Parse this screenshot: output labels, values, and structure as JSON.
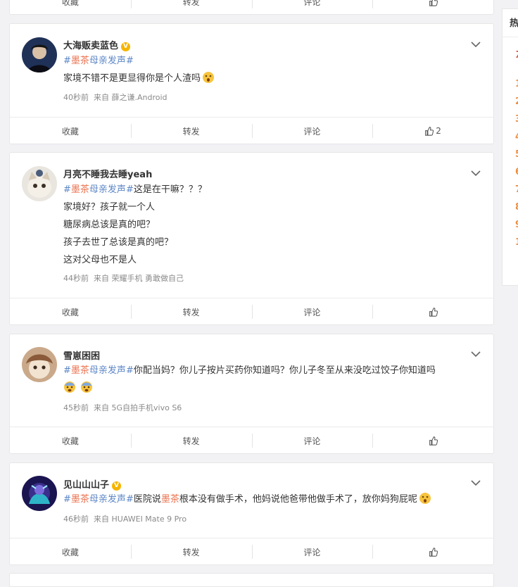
{
  "colors": {
    "hashtag_red": "#eb7350",
    "hashtag_blue": "#5d87c6",
    "page_bg": "#f2f2f5",
    "verified": "#f5b400"
  },
  "top_partial_actions": {
    "collect": "收藏",
    "repost": "转发",
    "comment": "评论"
  },
  "posts": [
    {
      "username": "大海贩卖蓝色",
      "verified": true,
      "lines": [
        {
          "tag_a": "#",
          "tag_b": "墨茶",
          "tag_c": "母亲发声",
          "tag_d": "#",
          "text": ""
        },
        {
          "text": "家境不错不是更显得你是个人渣吗"
        }
      ],
      "emoji": "astonished-emoji",
      "time": "40秒前",
      "source": "来自 薛之谦.Android",
      "actions": {
        "collect": "收藏",
        "repost": "转发",
        "comment": "评论",
        "likes": "2"
      }
    },
    {
      "username": "月亮不睡我去睡yeah",
      "verified": false,
      "lines": [
        {
          "tag_a": "#",
          "tag_b": "墨茶",
          "tag_c": "母亲发声",
          "tag_d": "#",
          "text": "这是在干嘛？？？"
        },
        {
          "text": "家境好？孩子就一个人"
        },
        {
          "text": "糖尿病总该是真的吧？"
        },
        {
          "text": "孩子去世了总该是真的吧？"
        },
        {
          "text": "这对父母也不是人"
        }
      ],
      "time": "44秒前",
      "source": "来自 荣耀手机 勇敢做自己",
      "actions": {
        "collect": "收藏",
        "repost": "转发",
        "comment": "评论",
        "likes": ""
      }
    },
    {
      "username": "雪崽困困",
      "verified": false,
      "lines": [
        {
          "tag_a": "#",
          "tag_b": "墨茶",
          "tag_c": "母亲发声",
          "tag_d": "#",
          "text": "你配当妈？你儿子按片买药你知道吗？你儿子冬至从来没吃过饺子你知道吗"
        }
      ],
      "emoji": "fearful-emoji",
      "time": "45秒前",
      "source": "来自 5G自拍手机vivo S6",
      "actions": {
        "collect": "收藏",
        "repost": "转发",
        "comment": "评论",
        "likes": ""
      }
    },
    {
      "username": "见山山山子",
      "verified": true,
      "lines": [
        {
          "tag_a": "#",
          "tag_b": "墨茶",
          "tag_c": "母亲发声",
          "tag_d": "#",
          "text_a": "医院说",
          "text_b": "墨茶",
          "text_c": "根本没有做手术，他妈说他爸带他做手术了，放你妈狗屁呢"
        }
      ],
      "emoji": "astonished-emoji",
      "time": "46秒前",
      "source": "来自 HUAWEI Mate 9 Pro",
      "actions": {
        "collect": "收藏",
        "repost": "转发",
        "comment": "评论",
        "likes": ""
      }
    }
  ],
  "sidebar": {
    "title": "热",
    "ranks": [
      "7",
      "1",
      "2",
      "3",
      "4",
      "5",
      "6",
      "7",
      "8",
      "9",
      "1"
    ]
  }
}
